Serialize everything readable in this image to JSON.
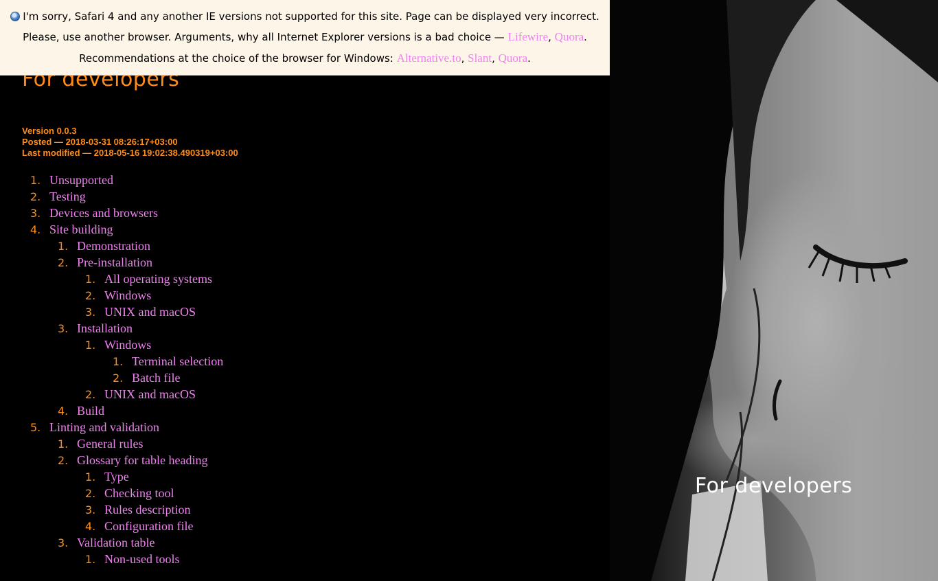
{
  "banner": {
    "line1": "I'm sorry, Safari 4 and any another IE versions not supported for this site. Page can be displayed very incorrect.",
    "line2_text": "Please, use another browser. Arguments, why all Internet Explorer versions is a bad choice — ",
    "line2_links": [
      "Lifewire",
      "Quora"
    ],
    "line3_text": "Recommendations at the choice of the browser for Windows: ",
    "line3_links": [
      "Alternative.to",
      "Slant",
      "Quora"
    ],
    "sep": ", ",
    "end": "."
  },
  "page": {
    "title": "For developers",
    "version": "Version 0.0.3",
    "posted": "Posted — 2018-03-31 08:26:17+03:00",
    "modified": "Last modified — 2018-05-16 19:02:38.490319+03:00"
  },
  "toc": [
    {
      "level": 1,
      "num": "1.",
      "label": "Unsupported"
    },
    {
      "level": 1,
      "num": "2.",
      "label": "Testing"
    },
    {
      "level": 1,
      "num": "3.",
      "label": "Devices and browsers"
    },
    {
      "level": 1,
      "num": "4.",
      "label": "Site building"
    },
    {
      "level": 2,
      "num": "1.",
      "label": "Demonstration"
    },
    {
      "level": 2,
      "num": "2.",
      "label": "Pre-installation"
    },
    {
      "level": 3,
      "num": "1.",
      "label": "All operating systems"
    },
    {
      "level": 3,
      "num": "2.",
      "label": "Windows"
    },
    {
      "level": 3,
      "num": "3.",
      "label": "UNIX and macOS"
    },
    {
      "level": 2,
      "num": "3.",
      "label": "Installation"
    },
    {
      "level": 3,
      "num": "1.",
      "label": "Windows"
    },
    {
      "level": 4,
      "num": "1.",
      "label": "Terminal selection"
    },
    {
      "level": 4,
      "num": "2.",
      "label": "Batch file"
    },
    {
      "level": 3,
      "num": "2.",
      "label": "UNIX and macOS"
    },
    {
      "level": 2,
      "num": "4.",
      "label": "Build"
    },
    {
      "level": 1,
      "num": "5.",
      "label": "Linting and validation"
    },
    {
      "level": 2,
      "num": "1.",
      "label": "General rules"
    },
    {
      "level": 2,
      "num": "2.",
      "label": "Glossary for table heading"
    },
    {
      "level": 3,
      "num": "1.",
      "label": "Type"
    },
    {
      "level": 3,
      "num": "2.",
      "label": "Checking tool"
    },
    {
      "level": 3,
      "num": "3.",
      "label": "Rules description"
    },
    {
      "level": 3,
      "num": "4.",
      "label": "Configuration file"
    },
    {
      "level": 2,
      "num": "3.",
      "label": "Validation table"
    },
    {
      "level": 3,
      "num": "1.",
      "label": "Non-used tools"
    }
  ],
  "photo": {
    "caption": "For developers"
  },
  "colors": {
    "accent": "#ff8c1a",
    "link": "#ee82ee",
    "banner_bg": "#fdf5e8",
    "page_bg": "#000000"
  },
  "icons": {
    "banner": "browser-globe-icon"
  }
}
